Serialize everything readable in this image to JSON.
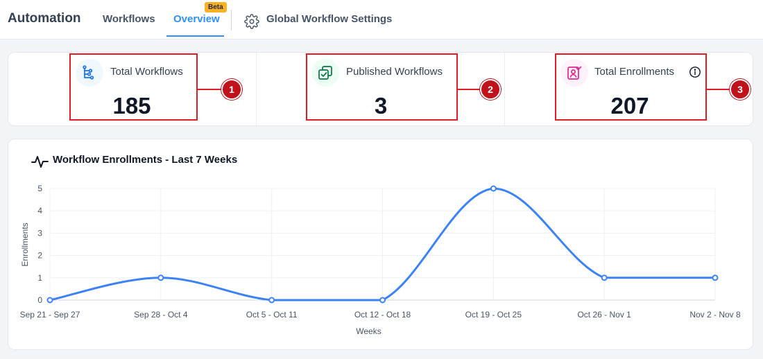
{
  "header": {
    "app_title": "Automation",
    "tabs": [
      {
        "label": "Workflows",
        "active": false
      },
      {
        "label": "Overview",
        "active": true,
        "badge": "Beta"
      }
    ],
    "settings_label": "Global Workflow Settings",
    "settings_icon": "gear-icon",
    "accent_color": "#2e90fa"
  },
  "stats": [
    {
      "label": "Total Workflows",
      "value": "185",
      "icon": "workflow-tree-icon",
      "annotation": "1"
    },
    {
      "label": "Published Workflows",
      "value": "3",
      "icon": "published-check-icon",
      "annotation": "2"
    },
    {
      "label": "Total Enrollments",
      "value": "207",
      "icon": "enrollment-person-icon",
      "info_icon": "info-icon",
      "annotation": "3"
    }
  ],
  "chart_title": "Workflow Enrollments - Last 7 Weeks",
  "chart_data": {
    "type": "line",
    "title": "Workflow Enrollments - Last 7 Weeks",
    "xlabel": "Weeks",
    "ylabel": "Enrollments",
    "categories": [
      "Sep 21 - Sep 27",
      "Sep 28 - Oct 4",
      "Oct 5 - Oct 11",
      "Oct 12 - Oct 18",
      "Oct 19 - Oct 25",
      "Oct 26 - Nov 1",
      "Nov 2 - Nov 8"
    ],
    "values": [
      0,
      1,
      0,
      0,
      5,
      1,
      1
    ],
    "ylim": [
      0,
      5
    ],
    "yticks": [
      "0",
      "1",
      "2",
      "3",
      "4",
      "5"
    ],
    "grid": true,
    "line_color": "#3b82f6"
  }
}
